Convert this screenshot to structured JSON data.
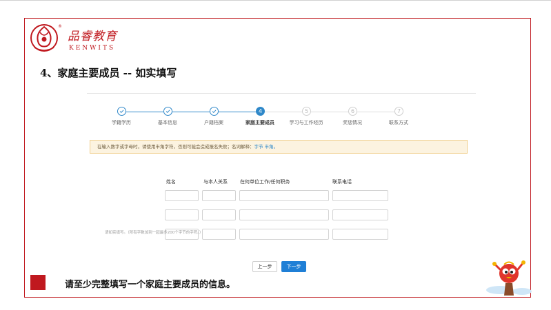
{
  "brand": {
    "name_cn": "品睿教育",
    "name_en": "KENWITS",
    "registered": "®",
    "color": "#c0191f"
  },
  "heading": "4、家庭主要成员 -- 如实填写",
  "steps": [
    {
      "label": "学籍学历",
      "number": "1",
      "state": "done"
    },
    {
      "label": "基本信息",
      "number": "2",
      "state": "done"
    },
    {
      "label": "户籍档案",
      "number": "3",
      "state": "done"
    },
    {
      "label": "家庭主要成员",
      "number": "4",
      "state": "active"
    },
    {
      "label": "学习与工作经历",
      "number": "5",
      "state": "pending"
    },
    {
      "label": "奖惩情况",
      "number": "6",
      "state": "pending"
    },
    {
      "label": "联系方式",
      "number": "7",
      "state": "pending"
    }
  ],
  "step_done_icon": "check-icon",
  "notice": {
    "text": "在输入数字或字母时，请使用半角字符，否则可能会造成报名失败；名词解释：",
    "link": "字节 半角。"
  },
  "form": {
    "columns": [
      "姓名",
      "与本人关系",
      "在何单位工作/任何职务",
      "联系电话"
    ],
    "rows": [
      {
        "name": "",
        "relation": "",
        "work": "",
        "phone": ""
      },
      {
        "name": "",
        "relation": "",
        "work": "",
        "phone": ""
      },
      {
        "name": "",
        "relation": "",
        "work": "",
        "phone": ""
      }
    ],
    "hint": "请如实填写。（所有字数加到一起最多200个字节的字符。）"
  },
  "buttons": {
    "prev": "上一步",
    "next": "下一步"
  },
  "footer": "请至少完整填写一个家庭主要成员的信息。",
  "colors": {
    "accent": "#2f88c9",
    "primary_button": "#1f7fd6",
    "notice_bg": "#fcf3e0",
    "notice_border": "#f0cf8c",
    "slide_border": "#c0191f"
  }
}
